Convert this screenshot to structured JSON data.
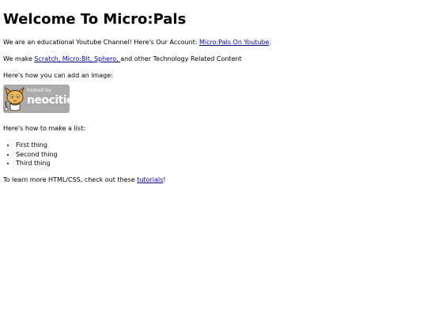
{
  "page": {
    "title": "Welcome To Micro:Pals",
    "intro": {
      "before": "We are an educational Youtube Channel! Here's Our Account: ",
      "link_text": "Micro:Pals On Youtube",
      "after": "."
    },
    "make": {
      "before": "We make ",
      "link_text": "Scratch, Micro:Bit, Sphero, ",
      "after": "and other Technology Related Content"
    },
    "image_intro": "Here's how you can add an image:",
    "badge": {
      "small_text": "hosted by",
      "brand_text": "neocities"
    },
    "list_intro": "Here's how to make a list:",
    "list_items": [
      "First thing",
      "Second thing",
      "Third thing"
    ],
    "learn_more": {
      "before": "To learn more HTML/CSS, check out these ",
      "link_text": "tutorials",
      "after": "!"
    }
  },
  "colors": {
    "link": "#0000ee",
    "badge_bg": "#ababab",
    "text": "#000000"
  }
}
